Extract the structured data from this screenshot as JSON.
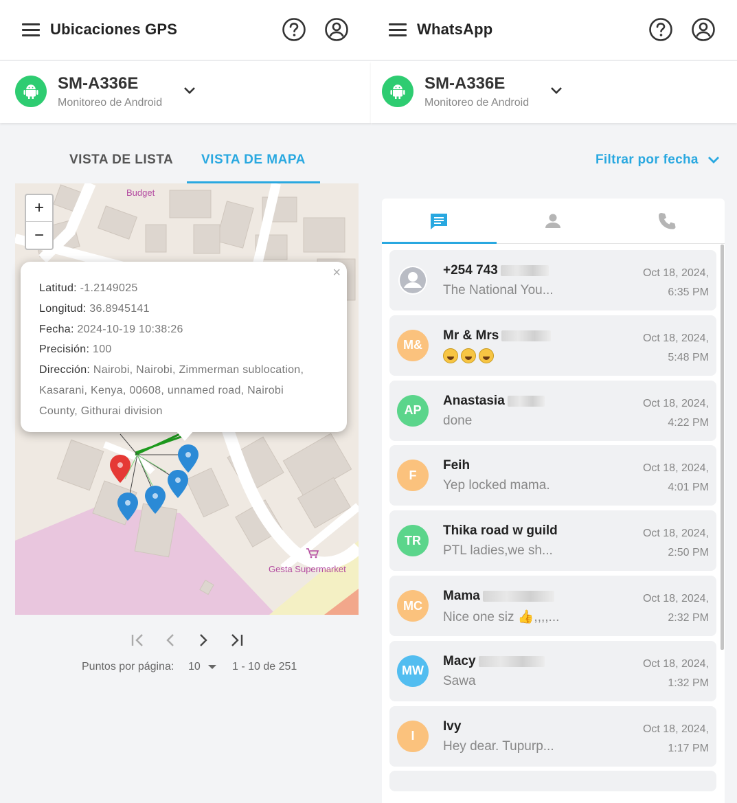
{
  "left": {
    "title": "Ubicaciones GPS",
    "device": {
      "name": "SM-A336E",
      "subtitle": "Monitoreo de Android"
    },
    "tabs": {
      "list": "VISTA DE LISTA",
      "map": "VISTA DE MAPA"
    },
    "map": {
      "labels": {
        "budget": "Budget",
        "supermarket": "Gesta Supermarket"
      },
      "zoom_in": "+",
      "zoom_out": "−",
      "popup": {
        "close": "×",
        "lat_label": "Latitud:",
        "lat": "-1.2149025",
        "lon_label": "Longitud:",
        "lon": "36.8945141",
        "date_label": "Fecha:",
        "date": "2024-10-19 10:38:26",
        "prec_label": "Precisión:",
        "prec": "100",
        "addr_label": "Dirección:",
        "addr_line1": "Nairobi, Nairobi, Zimmerman sublocation,",
        "addr_line2": "Kasarani, Kenya, 00608, unnamed road, Nairobi",
        "addr_line3": "County, Githurai division"
      }
    },
    "pagination": {
      "per_page_label": "Puntos por página:",
      "per_page_value": "10",
      "range": "1 - 10 de 251"
    }
  },
  "right": {
    "title": "WhatsApp",
    "device": {
      "name": "SM-A336E",
      "subtitle": "Monitoreo de Android"
    },
    "filter_label": "Filtrar por fecha",
    "chats": [
      {
        "name": "+254 743",
        "msg": "The National You...",
        "date": "Oct 18, 2024,",
        "time": "6:35 PM",
        "initials": "",
        "color": "#b9bcc4"
      },
      {
        "name": "Mr & Mrs",
        "msg": "",
        "date": "Oct 18, 2024,",
        "time": "5:48 PM",
        "initials": "M&",
        "color": "#fbc27d"
      },
      {
        "name": "Anastasia",
        "msg": "done",
        "date": "Oct 18, 2024,",
        "time": "4:22 PM",
        "initials": "AP",
        "color": "#5bd58b"
      },
      {
        "name": "Feih",
        "msg": "Yep locked mama.",
        "date": "Oct 18, 2024,",
        "time": "4:01 PM",
        "initials": "F",
        "color": "#fbc27d"
      },
      {
        "name": "Thika road w guild",
        "msg": "PTL ladies,we sh...",
        "date": "Oct 18, 2024,",
        "time": "2:50 PM",
        "initials": "TR",
        "color": "#5bd58b"
      },
      {
        "name": "Mama",
        "msg": "Nice one siz 👍,,,,...",
        "date": "Oct 18, 2024,",
        "time": "2:32 PM",
        "initials": "MC",
        "color": "#fbc27d"
      },
      {
        "name": "Macy",
        "msg": "Sawa",
        "date": "Oct 18, 2024,",
        "time": "1:32 PM",
        "initials": "MW",
        "color": "#52bdf0"
      },
      {
        "name": "Ivy",
        "msg": "Hey dear. Tupurp...",
        "date": "Oct 18, 2024,",
        "time": "1:17 PM",
        "initials": "I",
        "color": "#fbc27d"
      }
    ]
  }
}
